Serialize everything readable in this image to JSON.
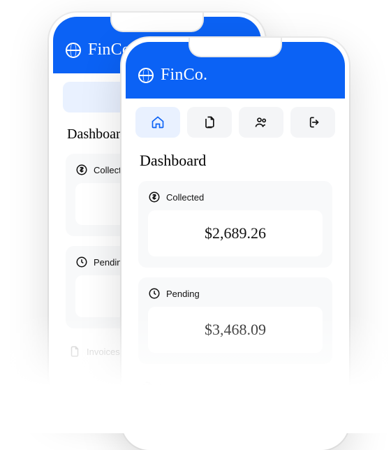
{
  "brand": "FinCo.",
  "nav": {
    "items": [
      {
        "name": "home-icon",
        "active": true
      },
      {
        "name": "document-icon",
        "active": false
      },
      {
        "name": "users-icon",
        "active": false
      },
      {
        "name": "logout-icon",
        "active": false
      }
    ]
  },
  "page": {
    "title": "Dashboard"
  },
  "cards": {
    "collected": {
      "label": "Collected",
      "value": "$2,689.26"
    },
    "pending": {
      "label": "Pending",
      "value": "$3,468.09"
    }
  },
  "sections": {
    "invoices": {
      "label": "Invoices"
    }
  },
  "back_phone": {
    "brand": "FinCo.",
    "title": "Dashboard",
    "collected_label": "Collected",
    "pending_label": "Pending",
    "invoices_label": "Invoices"
  }
}
